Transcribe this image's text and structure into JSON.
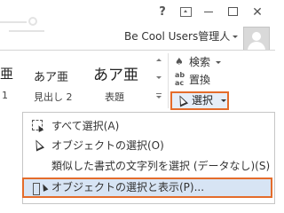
{
  "titlebar": {
    "help": "?",
    "user_name": "Be Cool Users管理人"
  },
  "styles": {
    "samples": [
      "亜",
      "あア亜",
      "あア亜"
    ],
    "names": [
      "1",
      "見出し 2",
      "表題"
    ]
  },
  "editing": {
    "find_label": "検索",
    "replace_label": "置換",
    "replace_icon": "ab/ac",
    "select_label": "選択"
  },
  "select_menu": {
    "items": [
      {
        "label": "すべて選択(A)",
        "icon": "select-all-icon"
      },
      {
        "label": "オブジェクトの選択(O)",
        "icon": "cursor-icon"
      },
      {
        "label": "類似した書式の文字列を選択 (データなし)(S)",
        "icon": ""
      },
      {
        "label": "オブジェクトの選択と表示(P)...",
        "icon": "selection-pane-icon",
        "highlighted": true
      }
    ]
  },
  "colors": {
    "highlight_border": "#e46c2b",
    "highlight_fill": "#d7e4f4"
  }
}
